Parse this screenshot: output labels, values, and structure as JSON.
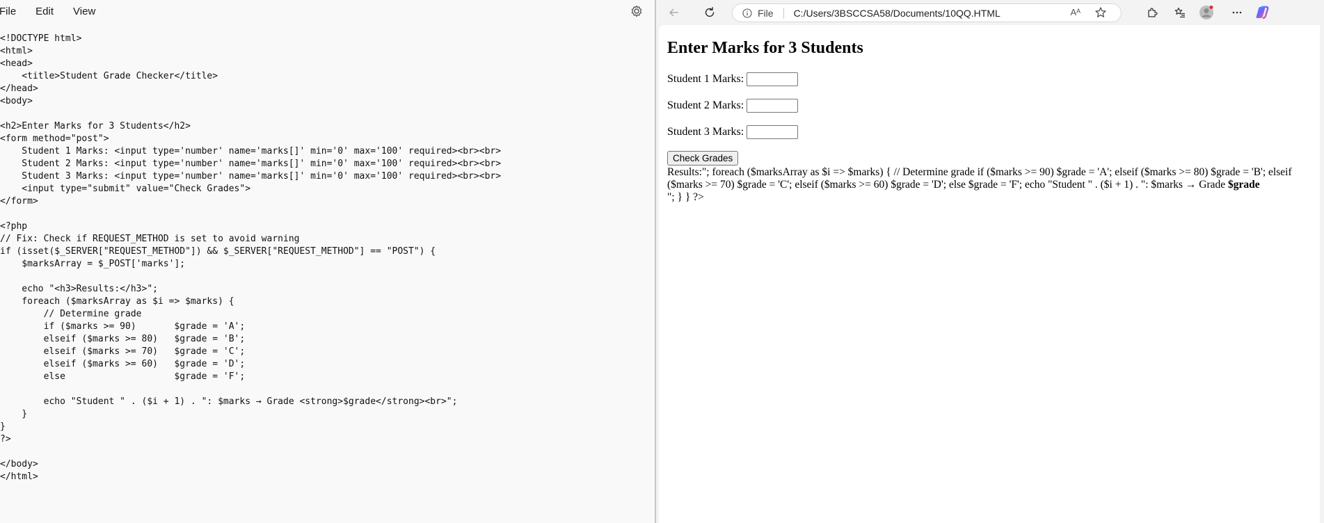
{
  "editor": {
    "menu": [
      "File",
      "Edit",
      "View"
    ],
    "settings_icon": "gear-icon",
    "code": "<!DOCTYPE html>\n<html>\n<head>\n    <title>Student Grade Checker</title>\n</head>\n<body>\n\n<h2>Enter Marks for 3 Students</h2>\n<form method=\"post\">\n    Student 1 Marks: <input type='number' name='marks[]' min='0' max='100' required><br><br>\n    Student 2 Marks: <input type='number' name='marks[]' min='0' max='100' required><br><br>\n    Student 3 Marks: <input type='number' name='marks[]' min='0' max='100' required><br><br>\n    <input type=\"submit\" value=\"Check Grades\">\n</form>\n\n<?php\n// Fix: Check if REQUEST_METHOD is set to avoid warning\nif (isset($_SERVER[\"REQUEST_METHOD\"]) && $_SERVER[\"REQUEST_METHOD\"] == \"POST\") {\n    $marksArray = $_POST['marks'];\n\n    echo \"<h3>Results:</h3>\";\n    foreach ($marksArray as $i => $marks) {\n        // Determine grade\n        if ($marks >= 90)       $grade = 'A';\n        elseif ($marks >= 80)   $grade = 'B';\n        elseif ($marks >= 70)   $grade = 'C';\n        elseif ($marks >= 60)   $grade = 'D';\n        else                    $grade = 'F';\n\n        echo \"Student \" . ($i + 1) . \": $marks → Grade <strong>$grade</strong><br>\";\n    }\n}\n?>\n\n</body>\n</html>"
  },
  "browser": {
    "address": {
      "scheme_label": "File",
      "url": "C:/Users/3BSCCSA58/Documents/10QQ.HTML",
      "read_aloud": "Aᴬ"
    },
    "page": {
      "heading": "Enter Marks for 3 Students",
      "students": [
        {
          "label": "Student 1 Marks:",
          "value": ""
        },
        {
          "label": "Student 2 Marks:",
          "value": ""
        },
        {
          "label": "Student 3 Marks:",
          "value": ""
        }
      ],
      "submit_label": "Check Grades",
      "output_plain": "Results:\"; foreach ($marksArray as $i => $marks) { // Determine grade if ($marks >= 90) $grade = 'A'; elseif ($marks >= 80) $grade = 'B'; elseif ($marks >= 70) $grade = 'C'; elseif ($marks >= 60) $grade = 'D'; else $grade = 'F'; echo \"Student \" . ($i + 1) . \": $marks → Grade ",
      "output_bold": "$grade",
      "output_tail": "\"; } } ?>"
    },
    "accent_color": "#0078d4"
  }
}
